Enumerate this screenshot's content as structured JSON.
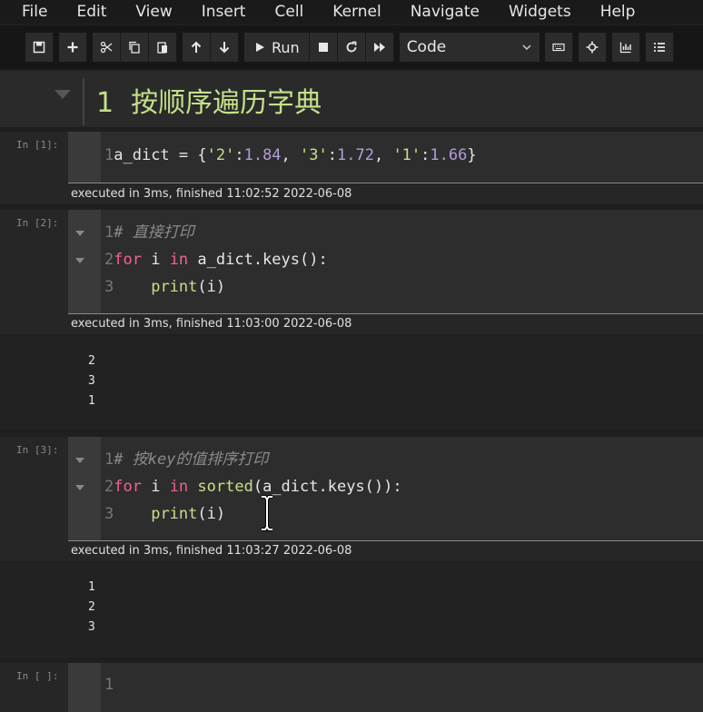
{
  "menu": [
    "File",
    "Edit",
    "View",
    "Insert",
    "Cell",
    "Kernel",
    "Navigate",
    "Widgets",
    "Help"
  ],
  "toolbar": {
    "run_label": "Run",
    "cell_type": "Code",
    "icons": [
      "save-icon",
      "plus-icon",
      "scissors-icon",
      "copy-icon",
      "paste-icon",
      "arrow-up-icon",
      "arrow-down-icon",
      "play-icon",
      "stop-icon",
      "restart-icon",
      "fast-forward-icon",
      "chevron-down-icon",
      "keyboard-icon",
      "crosshair-icon",
      "chart-icon",
      "list-icon"
    ]
  },
  "heading": {
    "number": "1",
    "text": "按顺序遍历字典"
  },
  "cells": [
    {
      "prompt": "In [1]:",
      "lines": [
        {
          "n": "1",
          "t": "a_dict = {'2':1.84, '3':1.72, '1':1.66}"
        }
      ],
      "exec": "executed in 3ms, finished 11:02:52 2022-06-08",
      "output": []
    },
    {
      "prompt": "In [2]:",
      "lines": [
        {
          "n": "1",
          "t": "# 直接打印"
        },
        {
          "n": "2",
          "t": "for i in a_dict.keys():"
        },
        {
          "n": "3",
          "t": "    print(i)"
        }
      ],
      "exec": "executed in 3ms, finished 11:03:00 2022-06-08",
      "output": [
        "2",
        "3",
        "1"
      ]
    },
    {
      "prompt": "In [3]:",
      "lines": [
        {
          "n": "1",
          "t": "# 按key的值排序打印"
        },
        {
          "n": "2",
          "t": "for i in sorted(a_dict.keys()):"
        },
        {
          "n": "3",
          "t": "    print(i)"
        }
      ],
      "exec": "executed in 3ms, finished 11:03:27 2022-06-08",
      "output": [
        "1",
        "2",
        "3"
      ]
    },
    {
      "prompt": "In [ ]:",
      "lines": [
        {
          "n": "1",
          "t": ""
        }
      ],
      "exec": "",
      "output": []
    }
  ],
  "tokens": {
    "c1": {
      "name": "a_dict",
      "eq": " = {",
      "k1": "'2'",
      "v1": "1.84",
      "k2": "'3'",
      "v2": "1.72",
      "k3": "'1'",
      "v3": "1.66",
      "close": "}"
    },
    "c2": {
      "comment": "# 直接打印",
      "kw_for": "for",
      "var": " i ",
      "kw_in": "in",
      "rest": " a_dict.keys():",
      "print": "print",
      "arg": "(i)"
    },
    "c3": {
      "comment": "# 按key的值排序打印",
      "kw_for": "for",
      "var": " i ",
      "kw_in": "in",
      "sorted": "sorted",
      "rest": "(a_dict.keys()):",
      "print": "print",
      "arg": "(i)"
    }
  },
  "colors": {
    "heading": "#c5e08a",
    "keyword": "#f06292",
    "number": "#b39ddb",
    "string": "#c5e08a",
    "comment": "#8a8a8a"
  }
}
